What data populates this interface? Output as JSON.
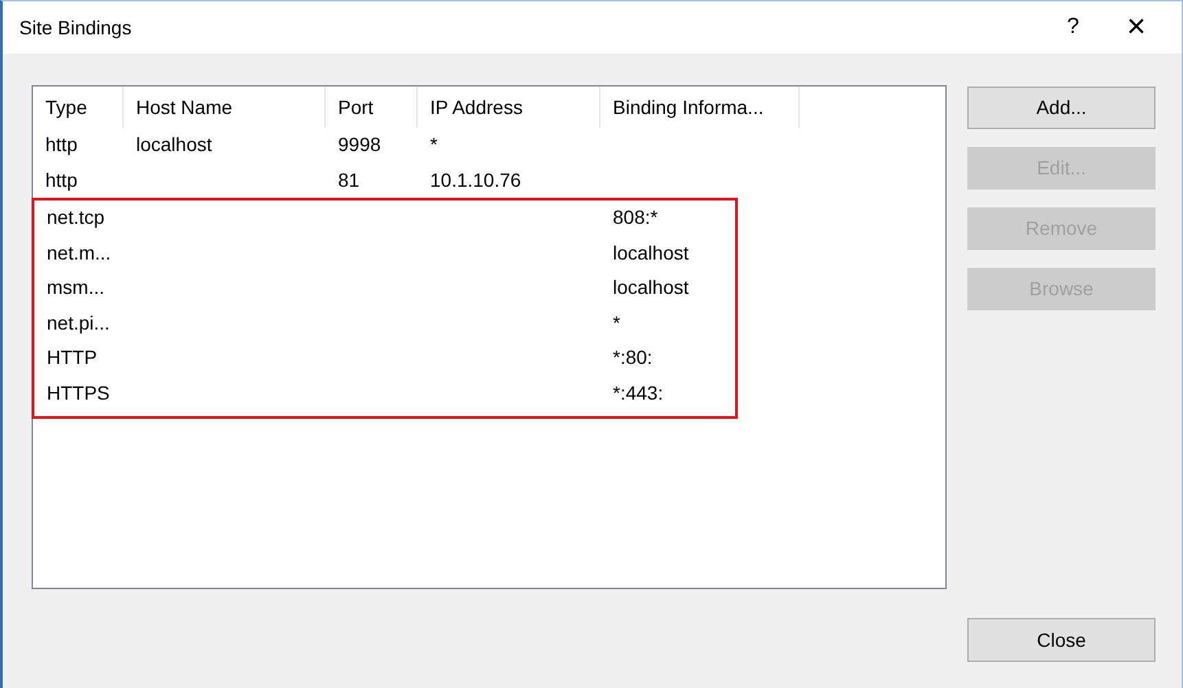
{
  "window": {
    "title": "Site Bindings",
    "help": "?",
    "close": "×"
  },
  "table": {
    "columns": [
      "Type",
      "Host Name",
      "Port",
      "IP Address",
      "Binding Informa..."
    ],
    "rows": [
      {
        "type": "http",
        "host_name": "localhost",
        "port": "9998",
        "ip_address": "*"
      },
      {
        "type": "http",
        "port": "81",
        "ip_address": "10.1.10.76"
      }
    ],
    "highlighted_rows": [
      {
        "type": "net.tcp",
        "binding_information": "808:*"
      },
      {
        "type": "net.m...",
        "binding_information": "localhost"
      },
      {
        "type": "msm...",
        "binding_information": "localhost"
      },
      {
        "type": "net.pi...",
        "binding_information": "*"
      },
      {
        "type": "HTTP",
        "binding_information": "*:80:"
      },
      {
        "type": "HTTPS",
        "binding_information": "*:443:"
      }
    ]
  },
  "buttons": [
    {
      "label": "Add...",
      "disabled": false
    },
    {
      "label": "Edit...",
      "disabled": true
    },
    {
      "label": "Remove",
      "disabled": true
    },
    {
      "label": "Browse",
      "disabled": true
    }
  ],
  "close_button": "Close"
}
